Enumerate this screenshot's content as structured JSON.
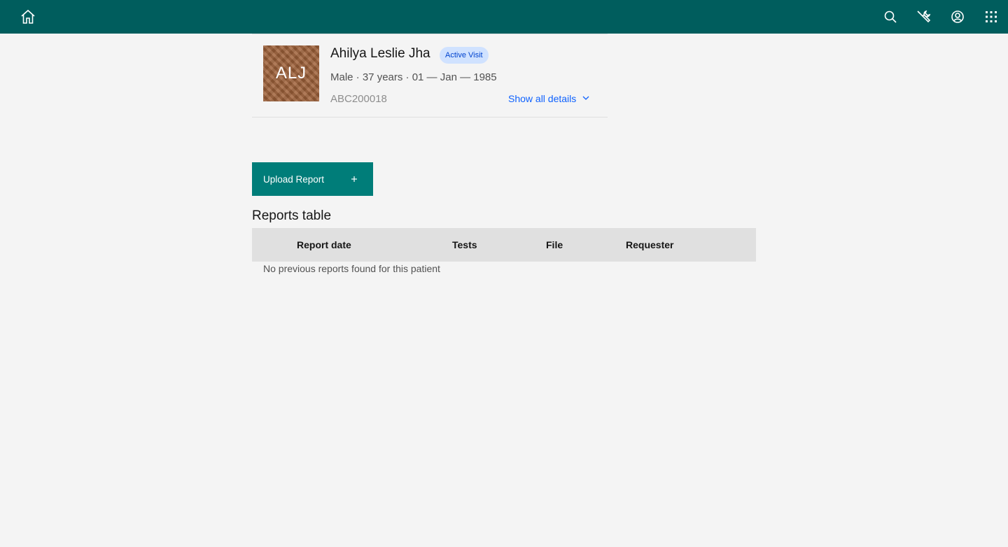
{
  "header": {
    "home_icon": "home-icon",
    "actions": [
      {
        "icon": "search-icon"
      },
      {
        "icon": "tools-icon"
      },
      {
        "icon": "user-avatar-icon"
      },
      {
        "icon": "app-switcher-icon"
      }
    ],
    "background": "#005d5d"
  },
  "patient": {
    "initials": "ALJ",
    "name": "Ahilya Leslie Jha",
    "visit_tag": "Active Visit",
    "demographics": "Male · 37 years · 01 — Jan — 1985",
    "identifier": "ABC200018",
    "show_details_label": "Show all details"
  },
  "actions": {
    "upload_label": "Upload Report",
    "upload_color": "#007d79"
  },
  "reports_table": {
    "title": "Reports table",
    "columns": [
      "Report date",
      "Tests",
      "File",
      "Requester"
    ],
    "empty_message": "No previous reports found for this patient"
  }
}
